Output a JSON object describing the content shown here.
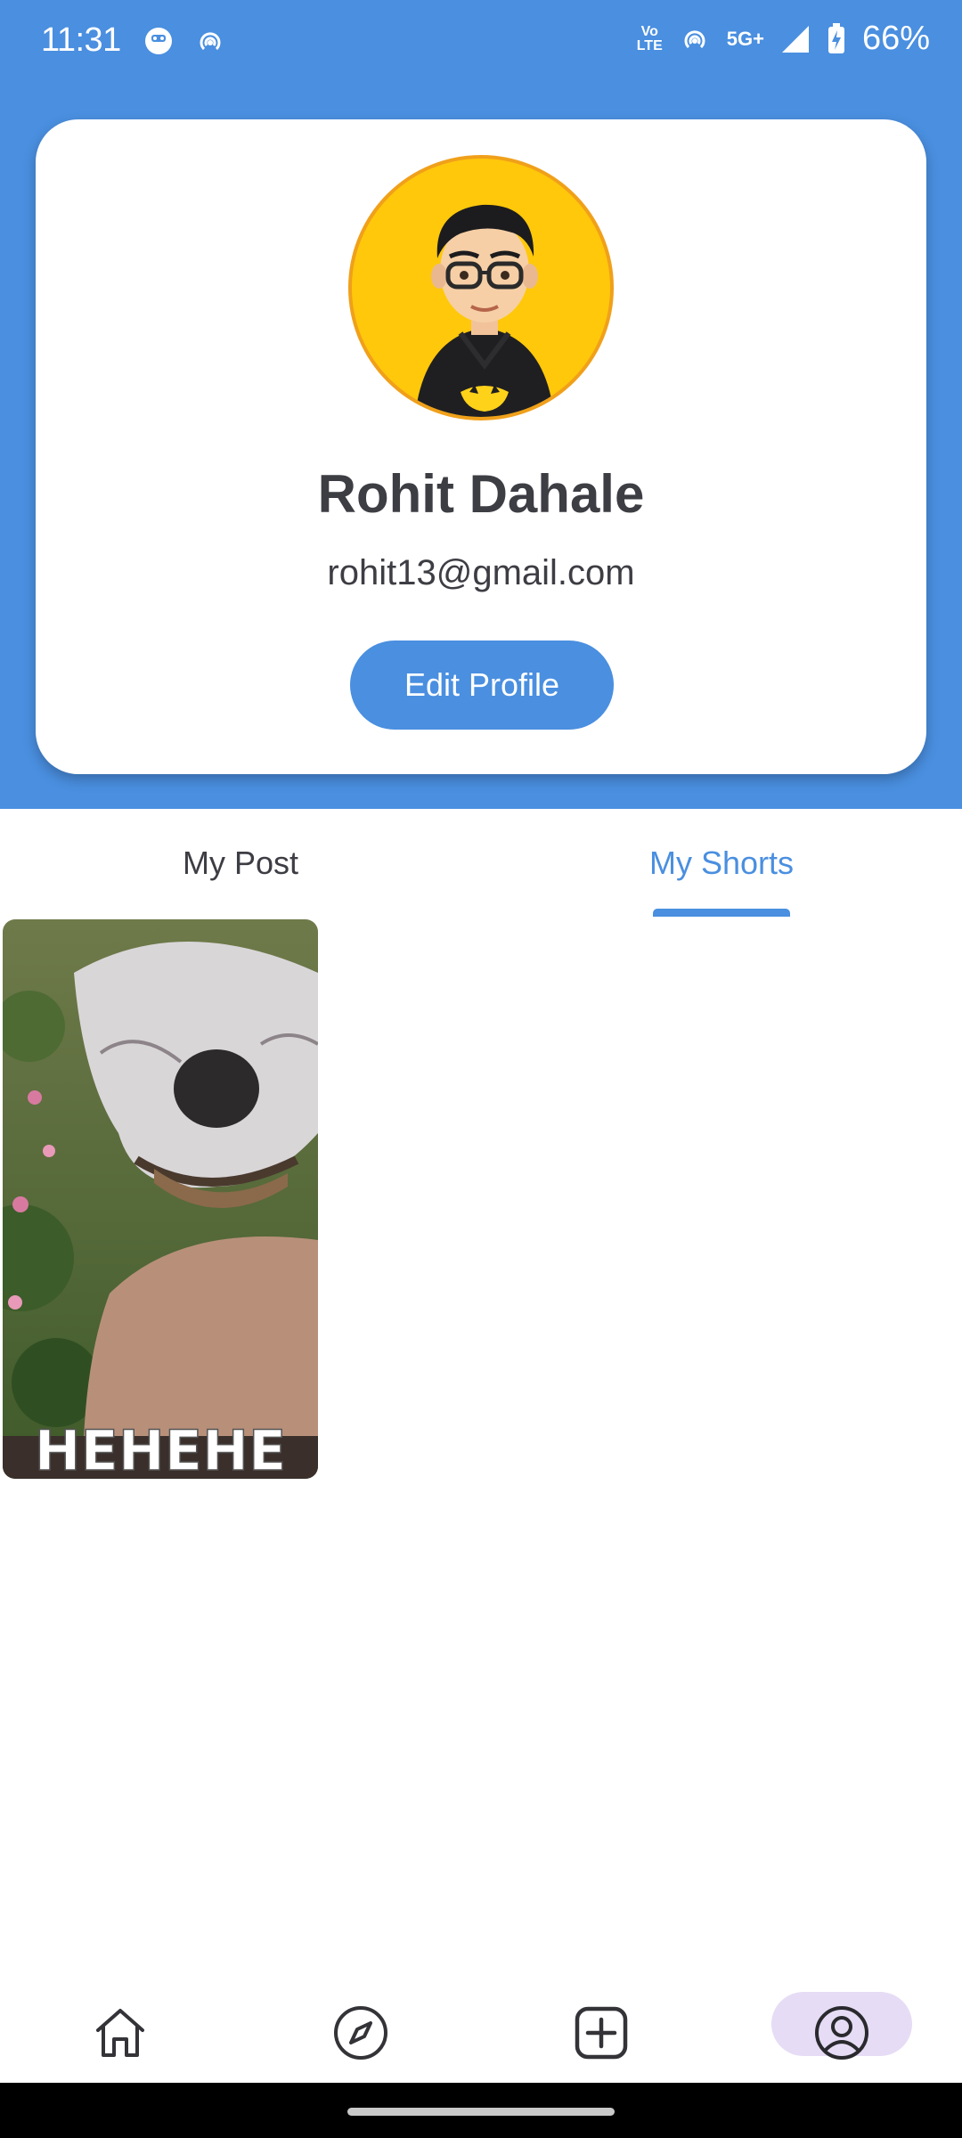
{
  "status_bar": {
    "time": "11:31",
    "network_label": "5G+",
    "volte_label": "Vo LTE",
    "battery": "66%",
    "icons": [
      "face-icon",
      "hotspot-icon",
      "volte-icon",
      "hotspot-icon",
      "signal-icon",
      "battery-charging-icon"
    ]
  },
  "profile": {
    "name": "Rohit Dahale",
    "email": "rohit13@gmail.com",
    "edit_label": "Edit Profile",
    "avatar": "bitmoji-avatar"
  },
  "tabs": [
    {
      "label": "My Post",
      "active": false
    },
    {
      "label": "My Shorts",
      "active": true
    }
  ],
  "shorts": [
    {
      "caption": "HEHEHE",
      "thumbnail": "smiling-dog-gif"
    }
  ],
  "bottom_nav": [
    {
      "icon": "home-icon",
      "active": false
    },
    {
      "icon": "compass-icon",
      "active": false
    },
    {
      "icon": "add-box-icon",
      "active": false
    },
    {
      "icon": "profile-icon",
      "active": true
    }
  ],
  "colors": {
    "primary": "#4a8fe0",
    "text": "#3d3d44",
    "nav_active": "#e6dcf5",
    "avatar_bg": "#ffc80a"
  }
}
